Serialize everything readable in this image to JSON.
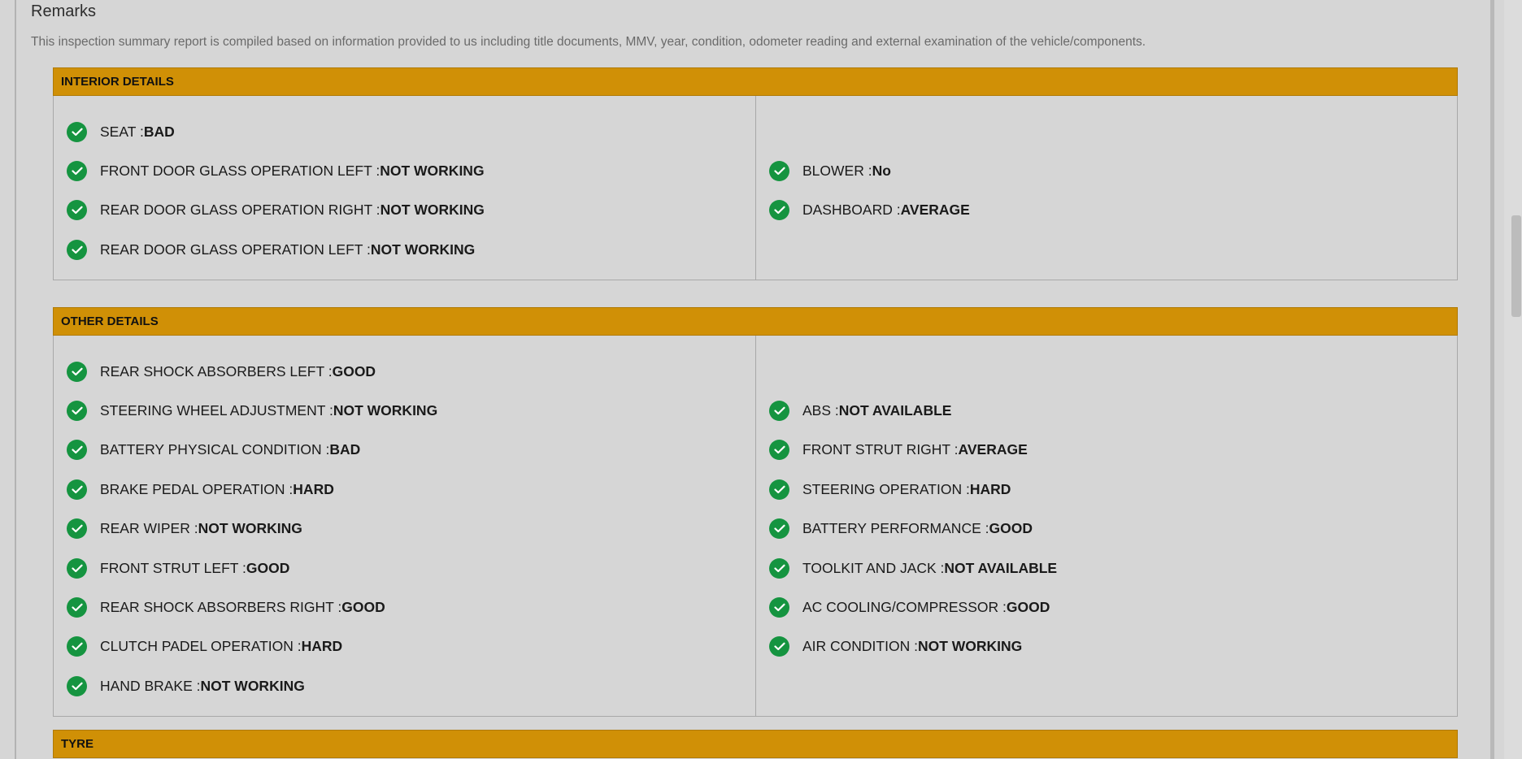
{
  "remarks": {
    "title": "Remarks",
    "text": "This inspection summary report is compiled based on information provided to us including title documents, MMV, year, condition, odometer reading and external examination of the vehicle/components."
  },
  "interior": {
    "title": "INTERIOR DETAILS",
    "left": [
      {
        "label": "SEAT : ",
        "value": "BAD"
      },
      {
        "label": "FRONT DOOR GLASS OPERATION LEFT : ",
        "value": "NOT WORKING"
      },
      {
        "label": "REAR DOOR GLASS OPERATION RIGHT : ",
        "value": "NOT WORKING"
      },
      {
        "label": "REAR DOOR GLASS OPERATION LEFT : ",
        "value": "NOT WORKING"
      }
    ],
    "right": [
      {
        "label": "BLOWER : ",
        "value": "No"
      },
      {
        "label": "DASHBOARD : ",
        "value": "AVERAGE"
      }
    ]
  },
  "other": {
    "title": "OTHER DETAILS",
    "left": [
      {
        "label": "REAR SHOCK ABSORBERS LEFT : ",
        "value": "GOOD"
      },
      {
        "label": "STEERING WHEEL ADJUSTMENT : ",
        "value": "NOT WORKING"
      },
      {
        "label": "BATTERY PHYSICAL CONDITION : ",
        "value": "BAD"
      },
      {
        "label": "BRAKE PEDAL OPERATION : ",
        "value": "HARD"
      },
      {
        "label": "REAR WIPER : ",
        "value": "NOT WORKING"
      },
      {
        "label": "FRONT STRUT LEFT : ",
        "value": "GOOD"
      },
      {
        "label": "REAR SHOCK ABSORBERS RIGHT : ",
        "value": "GOOD"
      },
      {
        "label": "CLUTCH PADEL OPERATION : ",
        "value": "HARD"
      },
      {
        "label": "HAND BRAKE : ",
        "value": "NOT WORKING"
      }
    ],
    "right": [
      {
        "label": "ABS : ",
        "value": "NOT AVAILABLE"
      },
      {
        "label": "FRONT STRUT RIGHT : ",
        "value": "AVERAGE"
      },
      {
        "label": "STEERING OPERATION : ",
        "value": "HARD"
      },
      {
        "label": "BATTERY PERFORMANCE : ",
        "value": "GOOD"
      },
      {
        "label": "TOOLKIT AND JACK : ",
        "value": "NOT AVAILABLE"
      },
      {
        "label": "AC COOLING/COMPRESSOR : ",
        "value": "GOOD"
      },
      {
        "label": "AIR CONDITION : ",
        "value": "NOT WORKING"
      }
    ]
  },
  "tyre": {
    "title": "TYRE"
  },
  "icons": {
    "status": "check-circle-icon"
  },
  "colors": {
    "header_bg": "#d09006",
    "check_green": "#159440",
    "page_bg": "#d6d6d6"
  }
}
